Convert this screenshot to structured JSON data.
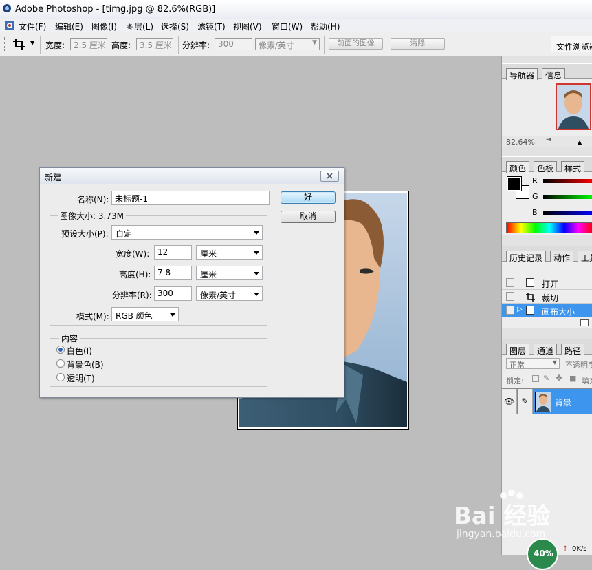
{
  "window": {
    "title": "Adobe Photoshop - [timg.jpg @ 82.6%(RGB)]"
  },
  "menu": [
    "文件(F)",
    "编辑(E)",
    "图像(I)",
    "图层(L)",
    "选择(S)",
    "滤镜(T)",
    "视图(V)",
    "窗口(W)",
    "帮助(H)"
  ],
  "options": {
    "width_label": "宽度:",
    "width_value": "2.5 厘米",
    "height_label": "高度:",
    "height_value": "3.5 厘米",
    "resolution_label": "分辨率:",
    "resolution_value": "300",
    "unit_value": "像素/英寸",
    "front_image_button": "前面的图像",
    "clear_button": "清除",
    "file_browser": "文件浏览器"
  },
  "panels": {
    "navigator": {
      "tabs": [
        "导航器",
        "信息"
      ],
      "zoom": "82.64%"
    },
    "color": {
      "tabs": [
        "颜色",
        "色板",
        "样式"
      ],
      "channels": [
        "R",
        "G",
        "B"
      ]
    },
    "history": {
      "tabs": [
        "历史记录",
        "动作",
        "工具"
      ],
      "items": [
        "打开",
        "裁切",
        "画布大小"
      ]
    },
    "layers": {
      "tabs": [
        "图层",
        "通道",
        "路径"
      ],
      "blend_mode": "正常",
      "opacity_label": "不透明度",
      "lock_label": "锁定:",
      "fill_label": "填充",
      "layer_name": "背景"
    }
  },
  "dialog": {
    "title": "新建",
    "name_label": "名称(N):",
    "name_value": "未标题-1",
    "image_size_label": "图像大小: 3.73M",
    "preset_label": "预设大小(P):",
    "preset_value": "自定",
    "width_label": "宽度(W):",
    "width_value": "12",
    "width_unit": "厘米",
    "height_label": "高度(H):",
    "height_value": "7.8",
    "height_unit": "厘米",
    "resolution_label": "分辨率(R):",
    "resolution_value": "300",
    "resolution_unit": "像素/英寸",
    "mode_label": "模式(M):",
    "mode_value": "RGB 颜色",
    "content_label": "内容",
    "content_options": [
      "白色(I)",
      "背景色(B)",
      "透明(T)"
    ],
    "selected_content": "白色(I)",
    "ok_button": "好",
    "cancel_button": "取消"
  },
  "watermark": {
    "text": "Bai 经验",
    "url": "jingyan.baidu.com"
  },
  "status": {
    "percent": "40%",
    "speed": "0K/s"
  }
}
